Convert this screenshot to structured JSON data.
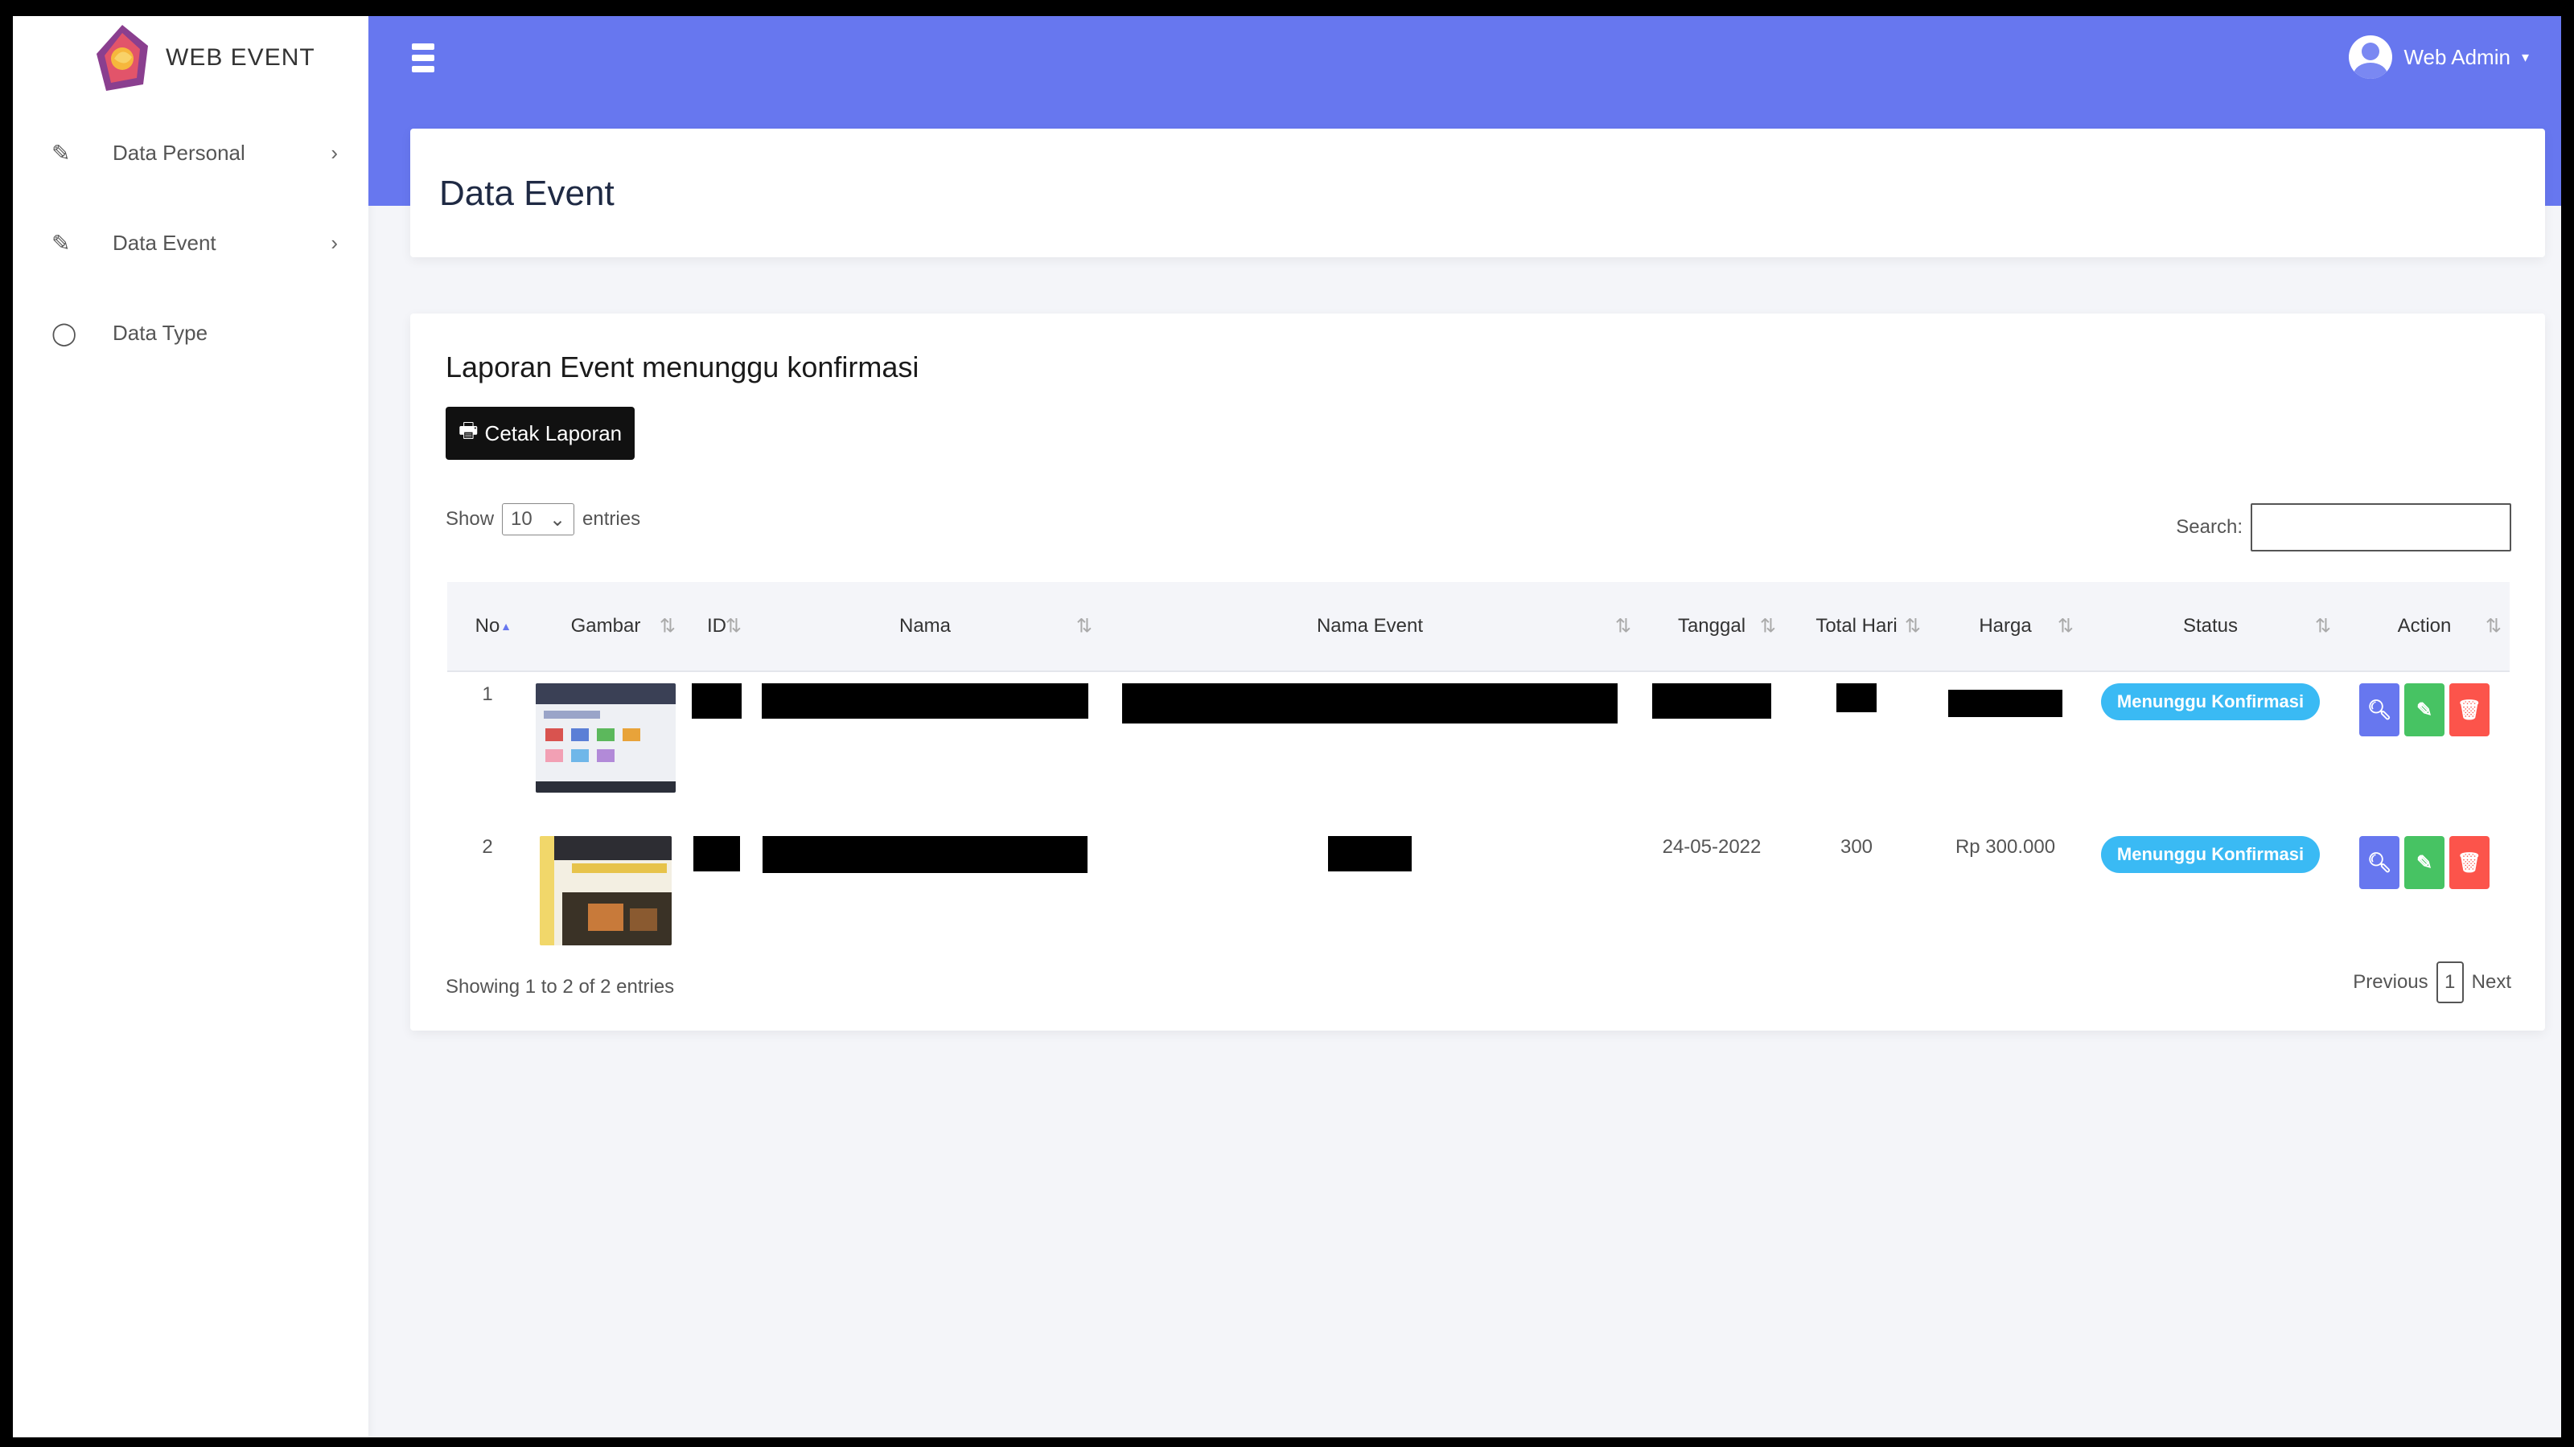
{
  "app": {
    "title": "WEB EVENT"
  },
  "sidebar": {
    "items": [
      {
        "label": "Data Personal",
        "icon": "edit-icon",
        "has_submenu": true
      },
      {
        "label": "Data Event",
        "icon": "edit-icon",
        "has_submenu": true
      },
      {
        "label": "Data Type",
        "icon": "circle-icon",
        "has_submenu": false
      }
    ]
  },
  "topbar": {
    "user_name": "Web Admin"
  },
  "page": {
    "title": "Data Event"
  },
  "report": {
    "title": "Laporan Event menunggu konfirmasi",
    "print_label": "Cetak Laporan",
    "show_label": "Show",
    "entries_value": "10",
    "entries_label": "entries",
    "search_label": "Search:",
    "search_value": "",
    "columns": [
      "No",
      "Gambar",
      "ID",
      "Nama",
      "Nama Event",
      "Tanggal",
      "Total Hari",
      "Harga",
      "Status",
      "Action"
    ],
    "rows": [
      {
        "no": "1",
        "tanggal": "",
        "total_hari": "",
        "harga": "",
        "status": "Menunggu Konfirmasi",
        "thumbnail": "ui-screenshot-thumbnail"
      },
      {
        "no": "2",
        "tanggal": "24-05-2022",
        "total_hari": "300",
        "harga": "Rp 300.000",
        "status": "Menunggu Konfirmasi",
        "thumbnail": "room-photo-thumbnail"
      }
    ],
    "info": "Showing 1 to 2 of 2 entries",
    "pagination": {
      "prev": "Previous",
      "page": "1",
      "next": "Next"
    }
  },
  "colors": {
    "primary": "#6777ef",
    "info": "#3abaf4",
    "success": "#47c363",
    "danger": "#fc544b"
  }
}
